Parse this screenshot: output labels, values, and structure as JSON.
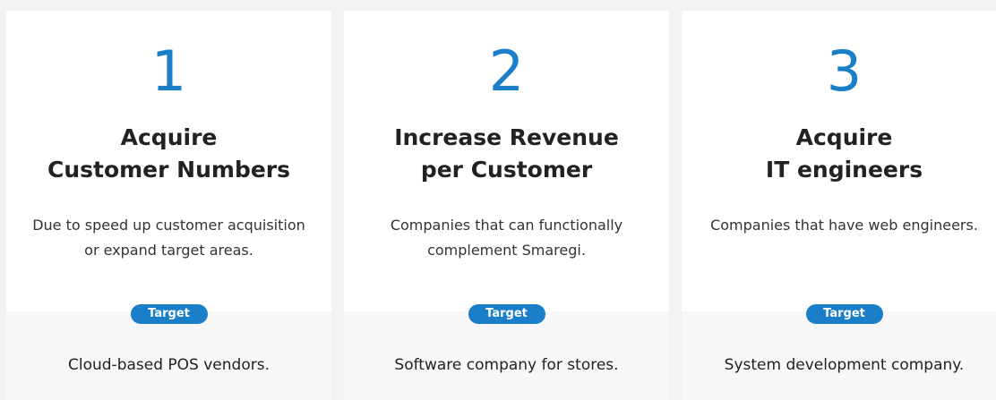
{
  "cards": [
    {
      "number": "1",
      "title": "Acquire\nCustomer Numbers",
      "description": "Due to speed up customer acquisition or expand target areas.",
      "badge": "Target",
      "target": "Cloud-based POS vendors."
    },
    {
      "number": "2",
      "title": "Increase Revenue\nper Customer",
      "description": "Companies that can functionally complement Smaregi.",
      "badge": "Target",
      "target": "Software company for stores."
    },
    {
      "number": "3",
      "title": "Acquire\nIT engineers",
      "description": "Companies that have web engineers.",
      "badge": "Target",
      "target": "System development company."
    }
  ],
  "colors": {
    "accent": "#1a7fc8",
    "background": "#f2f2f2",
    "card": "#ffffff",
    "card_bottom": "#f7f7f7"
  }
}
